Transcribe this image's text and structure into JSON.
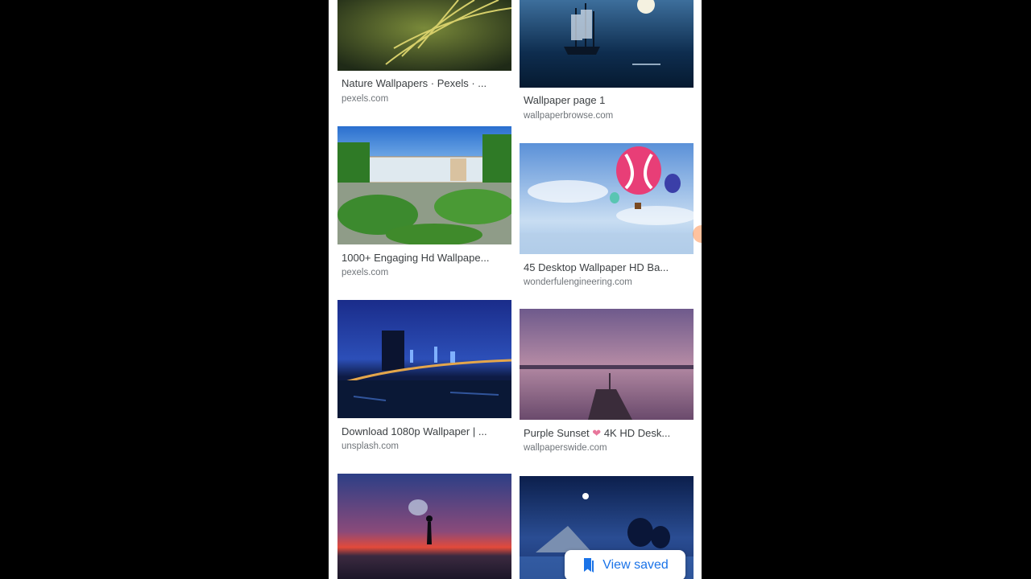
{
  "results": [
    {
      "title": "Nature Wallpapers · Pexels · ...",
      "source": "pexels.com"
    },
    {
      "title": "Wallpaper page 1",
      "source": "wallpaperbrowse.com"
    },
    {
      "title": "1000+ Engaging Hd Wallpape...",
      "source": "pexels.com"
    },
    {
      "title": "45 Desktop Wallpaper HD Ba...",
      "source": "wonderfulengineering.com"
    },
    {
      "title": "Download 1080p Wallpaper | ...",
      "source": "unsplash.com"
    },
    {
      "title_prefix": "Purple Sunset",
      "heart": "❤",
      "title_suffix": "4K HD Desk...",
      "source": "wallpaperswide.com"
    }
  ],
  "view_saved": {
    "label": "View saved",
    "icon": "bookmark-icon",
    "color": "#1a73e8"
  }
}
